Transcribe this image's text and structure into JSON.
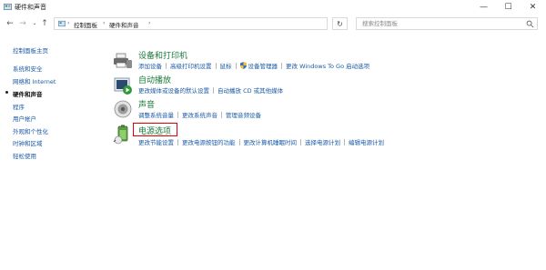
{
  "window": {
    "title": "硬件和声音",
    "minimize": "—",
    "maximize": "☐",
    "close": "✕"
  },
  "address": {
    "crumbs": [
      "控制面板",
      "硬件和声音"
    ],
    "search_placeholder": "搜索控制面板"
  },
  "leftnav": {
    "home": "控制面板主页",
    "items": [
      {
        "label": "系统和安全",
        "current": false
      },
      {
        "label": "网络和 Internet",
        "current": false
      },
      {
        "label": "硬件和声音",
        "current": true
      },
      {
        "label": "程序",
        "current": false
      },
      {
        "label": "用户帐户",
        "current": false
      },
      {
        "label": "外观和个性化",
        "current": false
      },
      {
        "label": "时钟和区域",
        "current": false
      },
      {
        "label": "轻松使用",
        "current": false
      }
    ]
  },
  "sections": [
    {
      "title": "设备和打印机",
      "icon": "printer-icon",
      "links": [
        "添加设备",
        "高级打印机设置",
        "鼠标",
        "设备管理器",
        "更改 Windows To Go 启动选项"
      ]
    },
    {
      "title": "自动播放",
      "icon": "autoplay-icon",
      "links": [
        "更改媒体或设备的默认设置",
        "自动播放 CD 或其他媒体"
      ]
    },
    {
      "title": "声音",
      "icon": "speaker-icon",
      "links": [
        "调整系统音量",
        "更改系统声音",
        "管理音频设备"
      ]
    },
    {
      "title": "电源选项",
      "icon": "power-options-icon",
      "links": [
        "更改节能设置",
        "更改电源按钮的功能",
        "更改计算机睡眠时间",
        "选择电源计划",
        "编辑电源计划"
      ]
    }
  ],
  "colors": {
    "link": "#1a5aa6",
    "section_title": "#1a7a3a",
    "highlight": "#e00000"
  }
}
